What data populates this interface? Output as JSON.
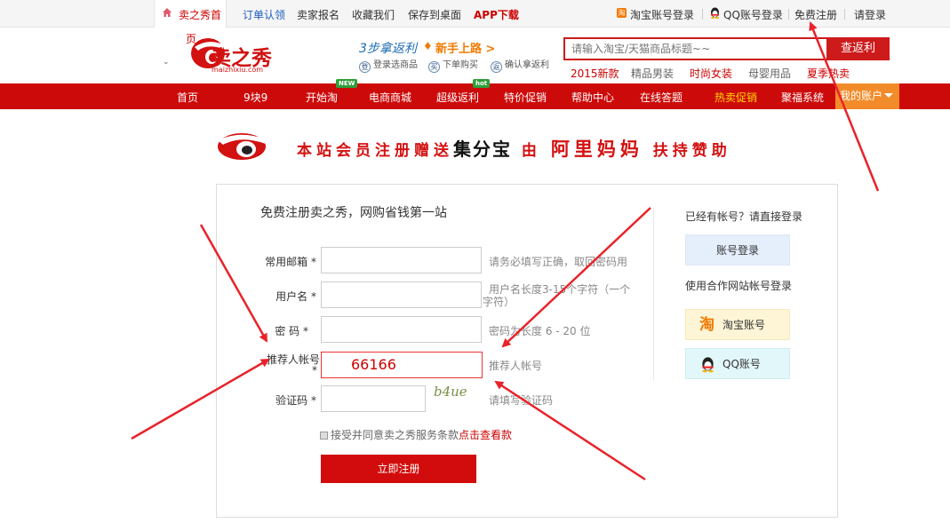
{
  "topbar": {
    "home_tab": "卖之秀首",
    "links_left": [
      "订单认领",
      "卖家报名",
      "收藏我们",
      "保存到桌面",
      "APP下载"
    ],
    "links_right": [
      "淘宝账号登录",
      "QQ账号登录",
      "免费注册",
      "请登录"
    ]
  },
  "header": {
    "logo_text": "卖之秀",
    "logo_url_text": "maizhixiu.com",
    "logo_fragment": "页",
    "promo_left": "3步拿返利",
    "promo_right": "新手上路 >",
    "steps": [
      "登录选商品",
      "下单购买",
      "确认拿返利"
    ],
    "step_icons": [
      "登",
      "买",
      "返"
    ],
    "search_placeholder": "请输入淘宝/天猫商品标题~~",
    "search_button": "查返利",
    "hot_keywords": [
      "2015新款",
      "精品男装",
      "时尚女装",
      "母婴用品",
      "夏季热卖"
    ]
  },
  "nav": {
    "items": [
      "首页",
      "9块9",
      "开始淘",
      "电商商城",
      "超级返利",
      "特价促销",
      "帮助中心",
      "在线答题",
      "热卖促销",
      "聚福系统"
    ],
    "badges": {
      "new": "NEW",
      "hot": "hot"
    },
    "account": "我的账户"
  },
  "banner": {
    "part1": "本站会员注册赠送",
    "part2": "集分宝",
    "part3": "由",
    "part4": "阿里妈妈",
    "part5": "扶持赞助"
  },
  "form": {
    "title": "免费注册卖之秀，网购省钱第一站",
    "fields": [
      {
        "label": "常用邮箱 *",
        "value": "",
        "hint": "请务必填写正确，取回密码用"
      },
      {
        "label": "用户名 *",
        "value": "",
        "hint": "用户名长度3-15个字符（一个",
        "hint2": "字符）"
      },
      {
        "label": "密  码 *",
        "value": "",
        "hint": "密码为长度 6 - 20 位"
      },
      {
        "label": "推荐人帐号",
        "label2": "*",
        "value": "66166",
        "hint": "推荐人帐号"
      },
      {
        "label": "验证码 *",
        "value": "",
        "hint": "请填写验证码"
      }
    ],
    "captcha_text": "b4ue",
    "agree_text": "接受并同意卖之秀服务条款",
    "agree_link": "点击查看款",
    "submit": "立即注册"
  },
  "side": {
    "login_title": "已经有帐号？请直接登录",
    "login_button": "账号登录",
    "partner_title": "使用合作网站帐号登录",
    "taobao_button": "淘宝账号",
    "qq_button": "QQ账号"
  },
  "colors": {
    "brand_red": "#cd0a0a",
    "account_orange": "#f28c2b",
    "link_blue": "#1a5dbd",
    "arrow_red": "#e8232a"
  }
}
